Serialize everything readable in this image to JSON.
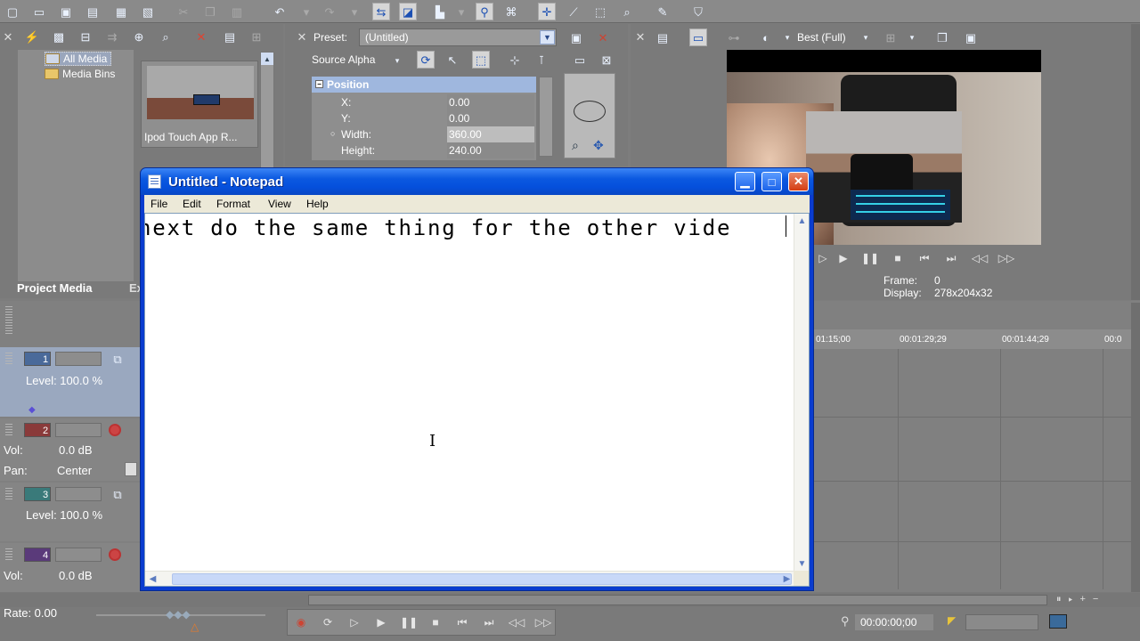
{
  "toolbar": {
    "icons": [
      "new-icon",
      "open-icon",
      "save-icon",
      "save-as-icon",
      "render-icon",
      "properties-icon",
      "cut-icon",
      "copy-icon",
      "paste-icon",
      "undo-icon",
      "redo-icon",
      "snap-icon",
      "auto-crossfade-icon",
      "ripple-icon",
      "lock-envelopes-icon",
      "ignore-grouping-icon",
      "normal-edit-icon",
      "envelope-edit-icon",
      "selection-edit-icon",
      "zoom-edit-icon",
      "split-icon",
      "trim-icon"
    ]
  },
  "media_panel": {
    "tree": [
      "All Media",
      "Media Bins"
    ],
    "thumb_label": "Ipod Touch App R...",
    "tab_label": "Project Media",
    "tab2_label": "Ex"
  },
  "event_pan": {
    "preset_label": "Preset:",
    "preset_value": "(Untitled)",
    "source_alpha": "Source Alpha",
    "section": "Position",
    "props": [
      {
        "k": "X:",
        "v": "0.00"
      },
      {
        "k": "Y:",
        "v": "0.00"
      },
      {
        "k": "Width:",
        "v": "360.00"
      },
      {
        "k": "Height:",
        "v": "240.00"
      }
    ]
  },
  "preview": {
    "quality": "Best (Full)",
    "frame_label": "Frame:",
    "frame_value": "0",
    "display_label": "Display:",
    "display_value": "278x204x32"
  },
  "timeline": {
    "ruler": [
      "01:15;00",
      "00:01:29;29",
      "00:01:44;29",
      "00:0"
    ],
    "tracks": [
      {
        "num": "1",
        "label": "Level: 100.0 %",
        "color": "#4a6a9a"
      },
      {
        "num": "2",
        "vol": "0.0 dB",
        "pan": "Center",
        "color": "#8a3a3a"
      },
      {
        "num": "3",
        "label": "Level: 100.0 %",
        "color": "#3a7a7a"
      },
      {
        "num": "4",
        "vol": "0.0 dB",
        "color": "#5a3a7a"
      }
    ],
    "vol_label": "Vol:",
    "pan_label": "Pan:"
  },
  "bottom": {
    "rate": "Rate: 0.00",
    "timecode": "00:00:00;00"
  },
  "notepad": {
    "title": "Untitled - Notepad",
    "menu": [
      "File",
      "Edit",
      "Format",
      "View",
      "Help"
    ],
    "text": "next do the same thing for the other vide"
  }
}
